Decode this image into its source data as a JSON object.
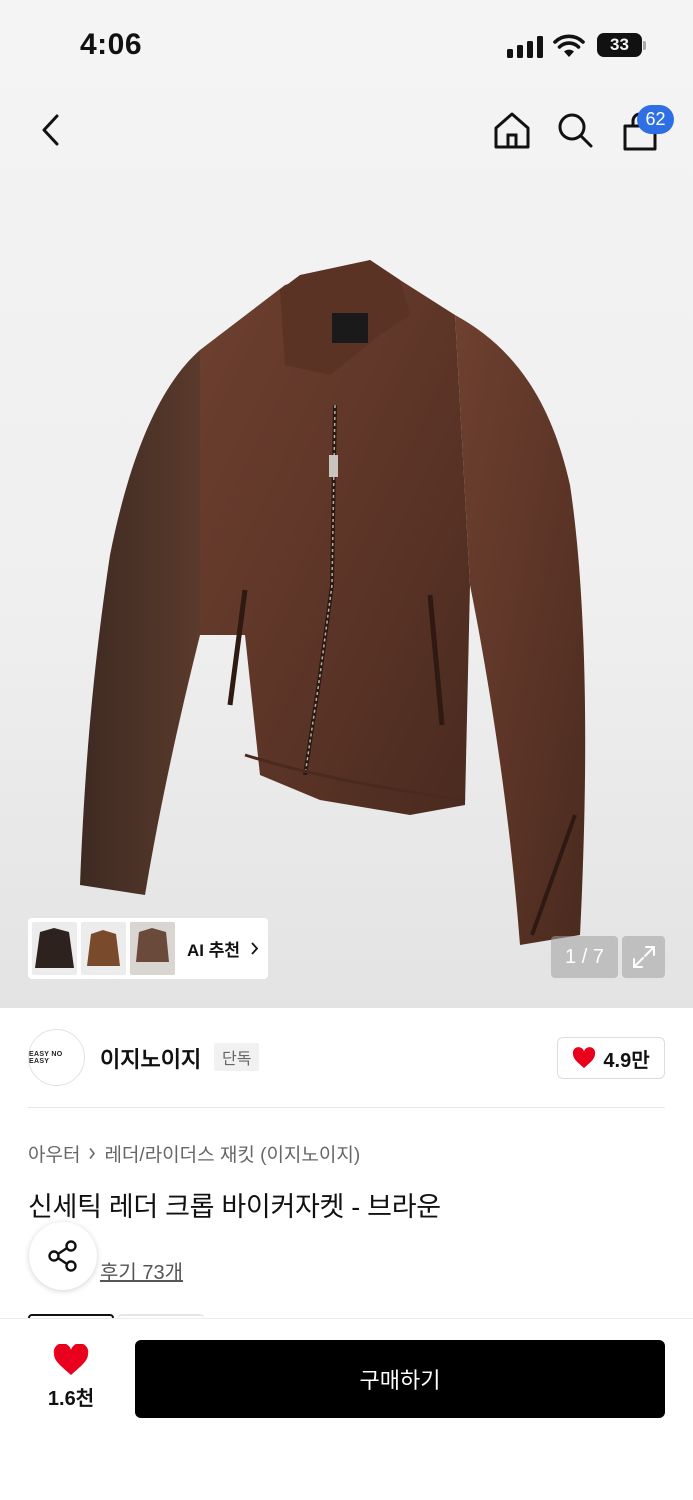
{
  "status_bar": {
    "time": "4:06",
    "battery": "33"
  },
  "nav": {
    "back_icon": "chevron-left-icon",
    "home_icon": "home-icon",
    "search_icon": "search-icon",
    "cart_icon": "shopping-bag-icon",
    "cart_count": "62"
  },
  "gallery": {
    "ai_label": "AI 추천",
    "counter": "1 / 7",
    "expand_icon": "expand-icon"
  },
  "brand": {
    "logo_text": "EASY NO EASY",
    "name": "이지노이지",
    "badge": "단독",
    "likes": "4.9만",
    "heart_color": "#e8001c"
  },
  "product": {
    "breadcrumb": [
      "아우터",
      "레더/라이더스 재킷 (이지노이지)"
    ],
    "title": "신세틱 레더 크롭 바이커자켓 - 브라운",
    "reviews": "후기 73개"
  },
  "bottom": {
    "wish_count": "1.6천",
    "buy_label": "구매하기"
  }
}
